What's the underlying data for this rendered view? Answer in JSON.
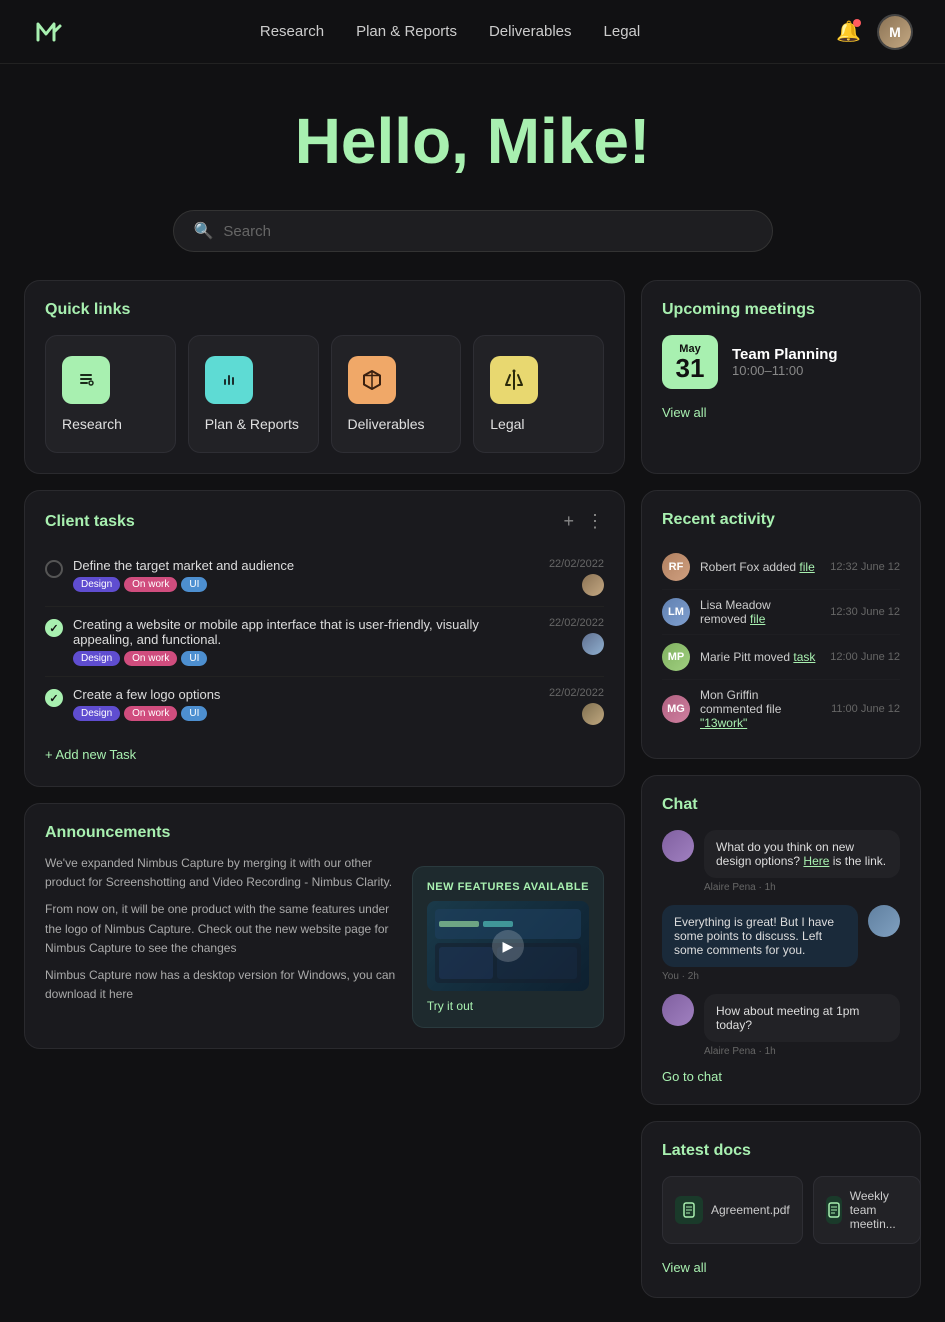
{
  "nav": {
    "logo_alt": "Nimbus Logo",
    "links": [
      {
        "label": "Research",
        "id": "research"
      },
      {
        "label": "Plan & Reports",
        "id": "plan-reports"
      },
      {
        "label": "Deliverables",
        "id": "deliverables"
      },
      {
        "label": "Legal",
        "id": "legal"
      }
    ],
    "user_initials": "M"
  },
  "hero": {
    "greeting": "Hello, ",
    "name": "Mike!",
    "title": "Hello, Mike!"
  },
  "search": {
    "placeholder": "Search"
  },
  "quick_links": {
    "title": "Quick links",
    "items": [
      {
        "label": "Research",
        "icon": "📋",
        "icon_color": "green",
        "id": "research"
      },
      {
        "label": "Plan & Reports",
        "icon": "📊",
        "icon_color": "teal",
        "id": "plan-reports"
      },
      {
        "label": "Deliverables",
        "icon": "📦",
        "icon_color": "orange",
        "id": "deliverables"
      },
      {
        "label": "Legal",
        "icon": "⚖️",
        "icon_color": "yellow",
        "id": "legal"
      }
    ]
  },
  "upcoming_meetings": {
    "title": "Upcoming meetings",
    "meeting": {
      "month": "May",
      "day": "31",
      "name": "Team Planning",
      "time": "10:00–11:00"
    },
    "view_all": "View all"
  },
  "client_tasks": {
    "title": "Client tasks",
    "add_label": "+ Add new Task",
    "tasks": [
      {
        "text": "Define the target market and audience",
        "done": false,
        "date": "22/02/2022",
        "tags": [
          "Design",
          "On work",
          "UI"
        ]
      },
      {
        "text": "Creating a website or mobile app interface that is user-friendly, visually appealing, and functional.",
        "done": true,
        "date": "22/02/2022",
        "tags": [
          "Design",
          "On work",
          "UI"
        ]
      },
      {
        "text": "Create a few logo options",
        "done": true,
        "date": "22/02/2022",
        "tags": [
          "Design",
          "On work",
          "UI"
        ]
      }
    ]
  },
  "announcements": {
    "title": "Announcements",
    "paragraphs": [
      "We've expanded Nimbus Capture by merging it with our other product for Screenshotting and Video Recording - Nimbus Clarity.",
      "From now on, it will be one product with the same features under the logo of Nimbus Capture. Check out the new website page for Nimbus Capture to see the changes",
      "Nimbus Capture now has a desktop version for Windows, you can download it here"
    ],
    "new_features": {
      "label": "NEW FEATURES AVAILABLE",
      "try_label": "Try it out"
    }
  },
  "recent_activity": {
    "title": "Recent activity",
    "items": [
      {
        "user": "Robert Fox",
        "action": "added",
        "target": "file",
        "time": "12:32 June 12",
        "color": "#b08060"
      },
      {
        "user": "Lisa Meadow",
        "action": "removed",
        "target": "file",
        "time": "12:30 June 12",
        "color": "#6080b0"
      },
      {
        "user": "Marie Pitt",
        "action": "moved",
        "target": "task",
        "time": "12:00 June 12",
        "color": "#80b060"
      },
      {
        "user": "Mon Griffin",
        "action": "commented file",
        "target": "\"13work\"",
        "time": "11:00 June 12",
        "color": "#b06080"
      }
    ]
  },
  "chat": {
    "title": "Chat",
    "messages": [
      {
        "sender": "Alaire Pena",
        "text_before": "What do you think on new design options? ",
        "link_text": "Here",
        "text_after": " is the link.",
        "meta": "Alaire Pena · 1h",
        "right": false,
        "color": "#8060a0"
      },
      {
        "sender": "You",
        "text_before": "Everything is great! But I have some points to discuss. Left some comments for you.",
        "link_text": "",
        "text_after": "",
        "meta": "You · 2h",
        "right": true,
        "color": "#6080a0"
      },
      {
        "sender": "Alaire Pena",
        "text_before": "How about meeting at 1pm today?",
        "link_text": "",
        "text_after": "",
        "meta": "Alaire Pena · 1h",
        "right": false,
        "color": "#8060a0"
      }
    ],
    "go_to_chat": "Go to chat"
  },
  "latest_docs": {
    "title": "Latest docs",
    "docs": [
      {
        "name": "Agreement.pdf",
        "icon": "📄"
      },
      {
        "name": "Weekly team meetin...",
        "icon": "📄"
      }
    ],
    "view_all": "View all"
  }
}
